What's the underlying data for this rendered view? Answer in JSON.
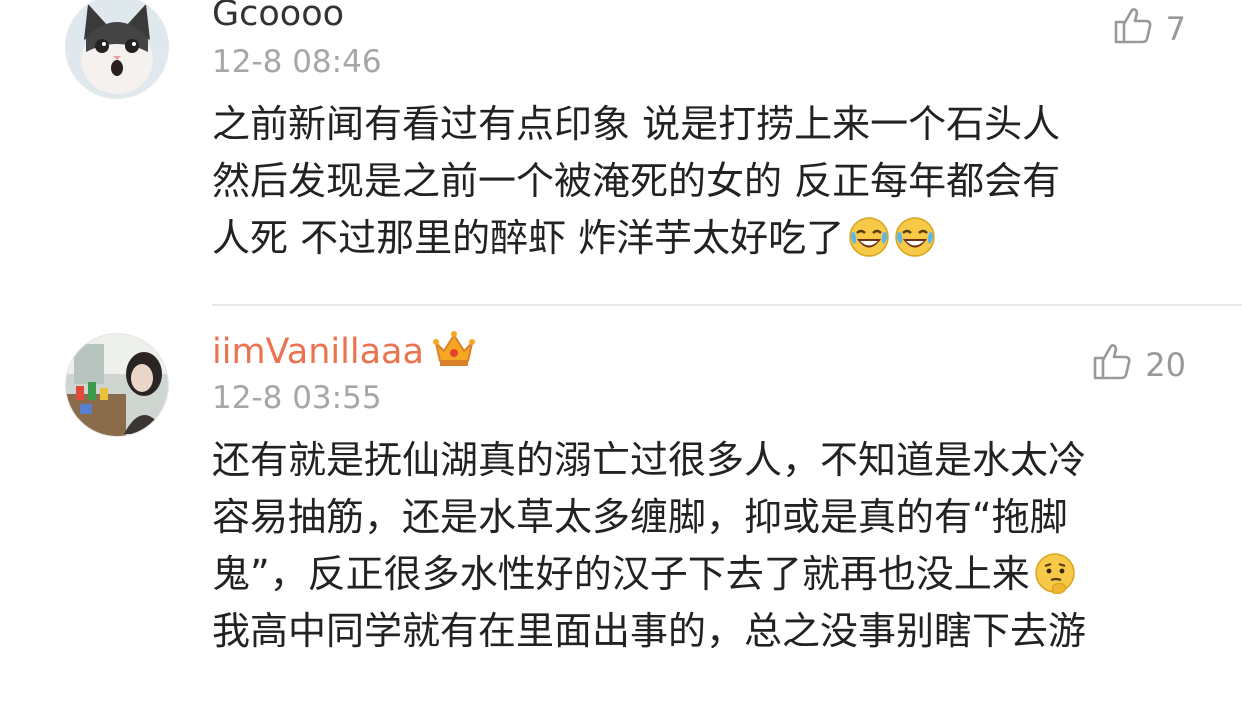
{
  "comments": [
    {
      "username": "Gcoooo",
      "timestamp": "12-8 08:46",
      "likes": "7",
      "vip": false,
      "lines": [
        "之前新闻有看过有点印象 说是打捞上来一个石头人",
        "然后发现是之前一个被淹死的女的  反正每年都会有",
        "人死 不过那里的醉虾 炸洋芋太好吃了"
      ],
      "emojis": [
        "laugh-cry-emoji",
        "laugh-cry-emoji"
      ]
    },
    {
      "username": "iimVanillaaa",
      "timestamp": "12-8 03:55",
      "likes": "20",
      "vip": true,
      "lines": [
        "还有就是抚仙湖真的溺亡过很多人，不知道是水太冷",
        "容易抽筋，还是水草太多缠脚，抑或是真的有“拖脚",
        "鬼”，反正很多水性好的汉子下去了就再也没上来",
        "我高中同学就有在里面出事的，总之没事别瞎下去游"
      ],
      "emojis": [
        "thinking-emoji"
      ]
    }
  ],
  "colors": {
    "vip_username": "#eb7350",
    "username": "#333333",
    "timestamp": "#a6a6a6",
    "like": "#999999",
    "divider": "#e8e8e8"
  }
}
